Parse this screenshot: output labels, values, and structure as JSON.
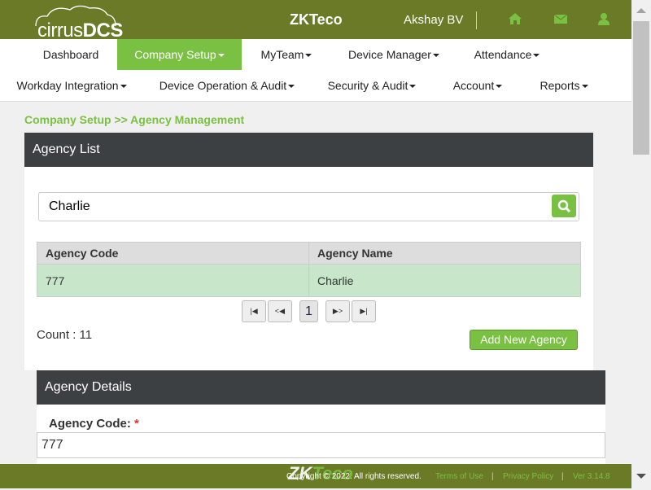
{
  "header": {
    "logo": "cirrusDCS",
    "brand": "ZKTeco",
    "user": "Akshay BV",
    "icons": [
      "home-icon",
      "envelope-icon",
      "user-icon"
    ],
    "color": "#6b7a26",
    "accent": "#7ac143"
  },
  "nav": {
    "row1": [
      {
        "label": "Dashboard",
        "caret": false
      },
      {
        "label": "Company Setup",
        "caret": true,
        "active": true
      },
      {
        "label": "MyTeam",
        "caret": true
      },
      {
        "label": "Device Manager",
        "caret": true
      },
      {
        "label": "Attendance",
        "caret": true
      }
    ],
    "row2": [
      {
        "label": "Workday Integration",
        "caret": true
      },
      {
        "label": "Device Operation & Audit",
        "caret": true
      },
      {
        "label": "Security & Audit",
        "caret": true
      },
      {
        "label": "Account",
        "caret": true
      },
      {
        "label": "Reports",
        "caret": true
      }
    ]
  },
  "breadcrumb": "Company Setup >> Agency Management",
  "agency_list": {
    "title": "Agency List",
    "search_value": "Charlie",
    "columns": [
      "Agency Code",
      "Agency Name"
    ],
    "rows": [
      [
        "777",
        "Charlie"
      ]
    ],
    "pager": {
      "current": "1"
    },
    "count": "Count : 11",
    "add_button": "Add New Agency"
  },
  "agency_details": {
    "title": "Agency Details",
    "code_label": "Agency Code:",
    "required": "*",
    "code_value": "777"
  },
  "footer": {
    "copyright": "Copyright © 2022. All rights reserved.",
    "terms": "Terms of Use",
    "privacy": "Privacy Policy",
    "version": "Ver 3.14.8",
    "logo": "ZKTeco"
  }
}
